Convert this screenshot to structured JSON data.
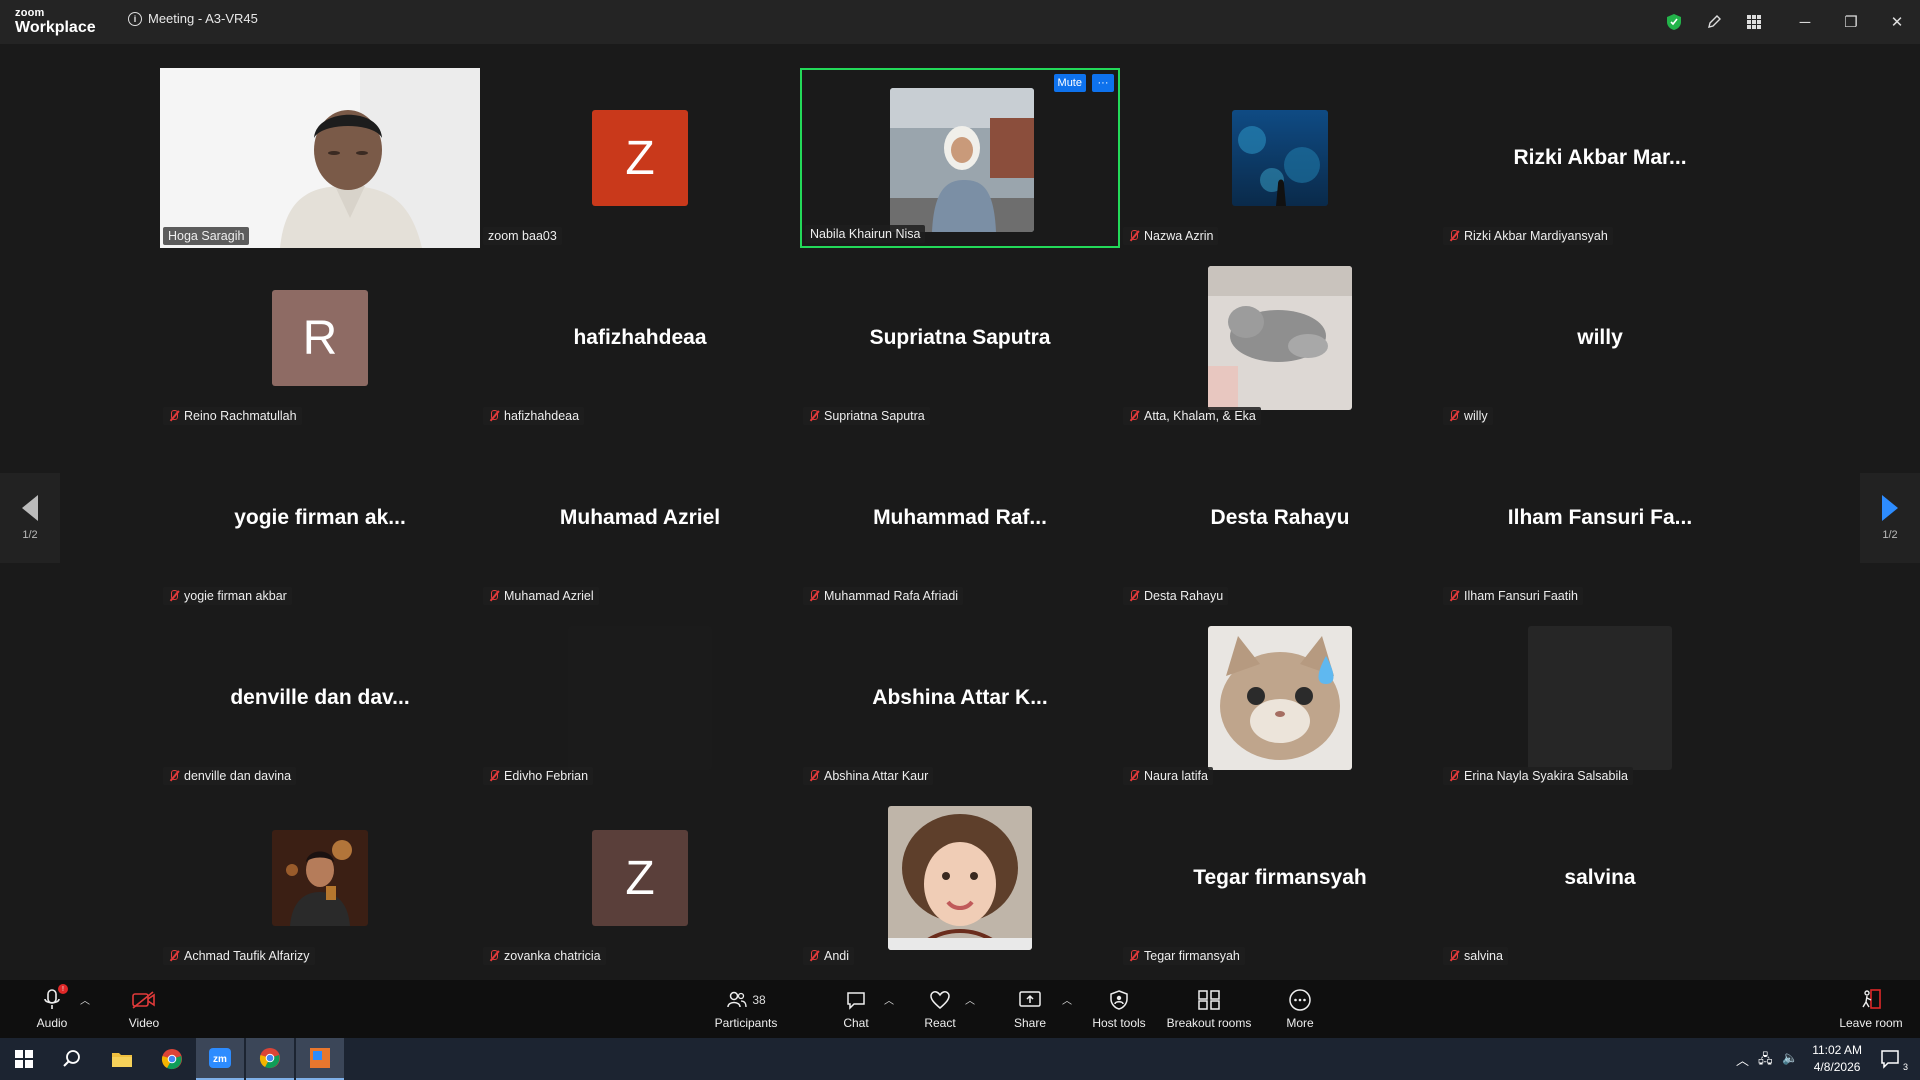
{
  "app": {
    "brand_top": "zoom",
    "brand_bottom": "Workplace",
    "meeting_title": "Meeting - A3-VR45"
  },
  "pager": {
    "left_label": "1/2",
    "right_label": "1/2"
  },
  "active_tile": {
    "mute_label": "Mute",
    "more_label": "···"
  },
  "tiles": [
    {
      "name": "Hoga Saragih",
      "big": "",
      "kind": "video",
      "muted": false
    },
    {
      "name": "zoom baa03",
      "big": "",
      "kind": "avatar",
      "letter": "Z",
      "color": "#c9391b",
      "muted": false
    },
    {
      "name": "Nabila Khairun Nisa",
      "big": "",
      "kind": "photo-person",
      "muted": false
    },
    {
      "name": "Nazwa Azrin",
      "big": "",
      "kind": "photo-sea",
      "muted": true
    },
    {
      "name": "Rizki Akbar Mardiyansyah",
      "big": "Rizki Akbar Mar...",
      "kind": "text",
      "muted": true
    },
    {
      "name": "Reino Rachmatullah",
      "big": "",
      "kind": "avatar",
      "letter": "R",
      "color": "#8e6b64",
      "muted": true
    },
    {
      "name": "hafizhahdeaa",
      "big": "hafizhahdeaa",
      "kind": "text",
      "muted": true
    },
    {
      "name": "Supriatna Saputra",
      "big": "Supriatna Saputra",
      "kind": "text",
      "muted": true
    },
    {
      "name": "Atta, Khalam, & Eka",
      "big": "",
      "kind": "photo-cat-lying",
      "muted": true
    },
    {
      "name": "willy",
      "big": "willy",
      "kind": "text",
      "muted": true
    },
    {
      "name": "yogie firman akbar",
      "big": "yogie firman ak...",
      "kind": "text",
      "muted": true
    },
    {
      "name": "Muhamad Azriel",
      "big": "Muhamad Azriel",
      "kind": "text",
      "muted": true
    },
    {
      "name": "Muhammad Rafa Afriadi",
      "big": "Muhammad  Raf...",
      "kind": "text",
      "muted": true
    },
    {
      "name": "Desta Rahayu",
      "big": "Desta Rahayu",
      "kind": "text",
      "muted": true
    },
    {
      "name": "Ilham Fansuri Faatih",
      "big": "Ilham Fansuri Fa...",
      "kind": "text",
      "muted": true
    },
    {
      "name": "denville dan davina",
      "big": "denville dan dav...",
      "kind": "text",
      "muted": true
    },
    {
      "name": "Edivho Febrian",
      "big": "",
      "kind": "photo-dark",
      "muted": true
    },
    {
      "name": "Abshina Attar Kaur",
      "big": "Abshina Attar K...",
      "kind": "text",
      "muted": true
    },
    {
      "name": "Naura latifa",
      "big": "",
      "kind": "photo-cat-face",
      "muted": true
    },
    {
      "name": "Erina Nayla Syakira Salsabila",
      "big": "",
      "kind": "photo-dark2",
      "muted": true
    },
    {
      "name": "Achmad Taufik Alfarizy",
      "big": "",
      "kind": "photo-man",
      "muted": true
    },
    {
      "name": "zovanka chatricia",
      "big": "",
      "kind": "avatar",
      "letter": "Z",
      "color": "#5a3f3a",
      "muted": true
    },
    {
      "name": "Andi",
      "big": "",
      "kind": "photo-child",
      "muted": true
    },
    {
      "name": "Tegar firmansyah",
      "big": "Tegar firmansyah",
      "kind": "text",
      "muted": true
    },
    {
      "name": "salvina",
      "big": "salvina",
      "kind": "text",
      "muted": true
    }
  ],
  "toolbar": {
    "audio": "Audio",
    "video": "Video",
    "participants": "Participants",
    "participants_count": "38",
    "chat": "Chat",
    "react": "React",
    "share": "Share",
    "host_tools": "Host tools",
    "breakout": "Breakout rooms",
    "more": "More",
    "leave": "Leave room"
  },
  "taskbar": {
    "time": "11:02 AM",
    "date": "4/8/2026",
    "notif_count": "3"
  },
  "colors": {
    "active_border": "#23d959",
    "accent_blue": "#0e72ed",
    "muted_red": "#e03a3a"
  }
}
